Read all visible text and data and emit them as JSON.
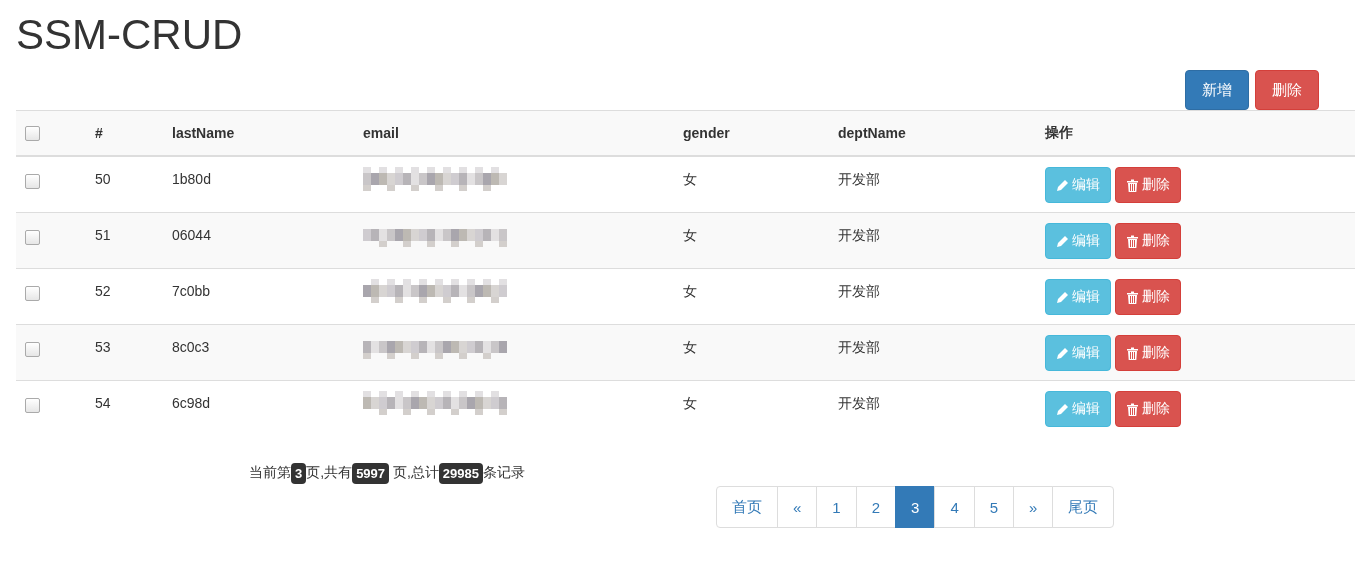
{
  "title": "SSM-CRUD",
  "actions": [
    {
      "label": "新增",
      "kind": "primary"
    },
    {
      "label": "删除",
      "kind": "danger"
    }
  ],
  "table": {
    "select_all": {
      "checked": false
    },
    "columns": [
      "#",
      "lastName",
      "email",
      "gender",
      "deptName",
      "操作"
    ],
    "rows": [
      {
        "checked": false,
        "id": "50",
        "lastName": "1b80d",
        "email": {
          "kind": "blurred"
        },
        "gender": "女",
        "deptName": "开发部",
        "edit": "编辑",
        "delete": "删除"
      },
      {
        "checked": false,
        "id": "51",
        "lastName": "06044",
        "email": {
          "kind": "blurred"
        },
        "gender": "女",
        "deptName": "开发部",
        "edit": "编辑",
        "delete": "删除"
      },
      {
        "checked": false,
        "id": "52",
        "lastName": "7c0bb",
        "email": {
          "kind": "blurred"
        },
        "gender": "女",
        "deptName": "开发部",
        "edit": "编辑",
        "delete": "删除"
      },
      {
        "checked": false,
        "id": "53",
        "lastName": "8c0c3",
        "email": {
          "kind": "blurred"
        },
        "gender": "女",
        "deptName": "开发部",
        "edit": "编辑",
        "delete": "删除"
      },
      {
        "checked": false,
        "id": "54",
        "lastName": "6c98d",
        "email": {
          "kind": "blurred"
        },
        "gender": "女",
        "deptName": "开发部",
        "edit": "编辑",
        "delete": "删除"
      }
    ]
  },
  "summary": [
    {
      "kind": "text",
      "text": "当前第"
    },
    {
      "kind": "badge",
      "text": "3"
    },
    {
      "kind": "text",
      "text": "页,共有"
    },
    {
      "kind": "badge",
      "text": "5997"
    },
    {
      "kind": "text",
      "text": " 页,总计"
    },
    {
      "kind": "badge",
      "text": "29985"
    },
    {
      "kind": "text",
      "text": "条记录"
    }
  ],
  "pagination": [
    {
      "label": "首页",
      "selected": false
    },
    {
      "label": "«",
      "selected": false
    },
    {
      "label": "1",
      "selected": false
    },
    {
      "label": "2",
      "selected": false
    },
    {
      "label": "3",
      "selected": true
    },
    {
      "label": "4",
      "selected": false
    },
    {
      "label": "5",
      "selected": false
    },
    {
      "label": "»",
      "selected": false
    },
    {
      "label": "尾页",
      "selected": false
    }
  ]
}
